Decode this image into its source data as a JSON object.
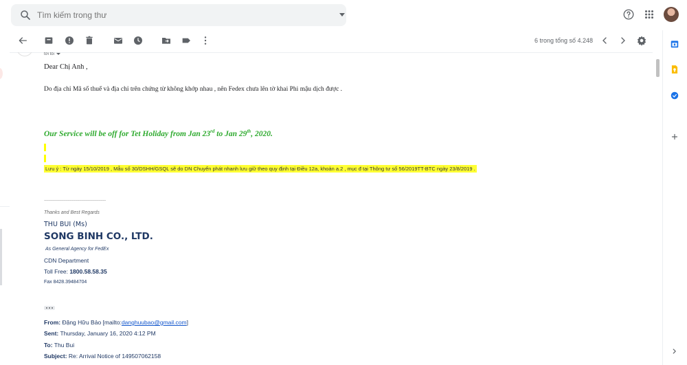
{
  "search": {
    "placeholder": "Tìm kiếm trong thư"
  },
  "toolbar": {
    "pager": "6 trong tổng số 4.248"
  },
  "email": {
    "to_label": "tới tôi",
    "greeting": "Dear Chị Anh ,",
    "paragraph": "Do địa chỉ Mã số thuế và địa chỉ trên chứng từ không khớp nhau , nên Fedex chưa lên tờ khai Phi mậu dịch được .",
    "holiday": {
      "part1": "Our Service will be off for Tet Holiday from Jan 23",
      "sup1": "rd",
      "part2": " to Jan 29",
      "sup2": "th",
      "part3": ", 2020."
    },
    "note": "Lưu ý : Từ ngày 15/10/2019 , Mẫu số 30/DSHH/GSQL sẽ do DN Chuyển phát nhanh lưu giữ theo quy định tại Điều 12a, khoản a.2 , mục đ tại Thông tư số 56/2019TT-BTC ngày 23/8/2019 .",
    "divider_dashes": "------------------------------------------------------------",
    "signature": {
      "thanks": "Thanks and Best Regards",
      "name": "THU BUI  (Ms)",
      "company": "SONG BINH CO., LTD.",
      "agency": "As General Agency for FedEx",
      "department": "CDN Department",
      "toll_label": "Toll Free: ",
      "toll_value": "1800.58.58.35",
      "fax": "Fax  8428.39484704"
    },
    "quoted": {
      "from_label": "From:",
      "from_name": " Đặng Hữu Bảo [mailto:",
      "from_email": "danghuubao@gmail.com",
      "from_close": "]",
      "sent_label": "Sent:",
      "sent_value": " Thursday, January 16, 2020 4:12 PM",
      "to_label": "To:",
      "to_value": " Thu Bui",
      "subject_label": "Subject:",
      "subject_value": " Re: Arrival Notice of 149507062158"
    }
  },
  "colors": {
    "holiday_green": "#2eaa2e",
    "highlight_yellow": "#ffff33",
    "signature_navy": "#1f3864",
    "link_blue": "#1155cc"
  },
  "icons": {
    "top": [
      "search-icon",
      "help-icon",
      "apps-grid-icon"
    ],
    "toolbar": [
      "back-arrow-icon",
      "archive-icon",
      "report-spam-icon",
      "delete-icon",
      "mark-unread-icon",
      "snooze-icon",
      "move-to-icon",
      "label-icon",
      "more-vert-icon",
      "chevron-left-icon",
      "chevron-right-icon",
      "settings-gear-icon"
    ],
    "side": [
      "calendar-icon",
      "keep-icon",
      "tasks-icon",
      "add-icon",
      "expand-chevron-icon"
    ]
  }
}
